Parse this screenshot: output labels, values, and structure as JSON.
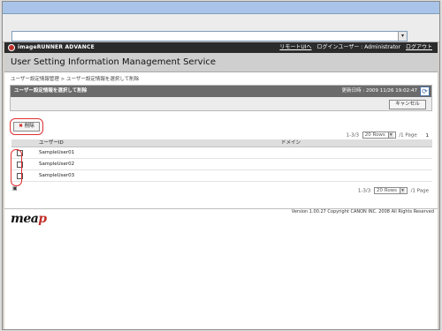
{
  "browser": {
    "address": "",
    "dropdown_icon": "▾"
  },
  "brandbar": {
    "product": "imageRUNNER ADVANCE",
    "remote_ui_link": "リモートUIへ",
    "login_user": "ログインユーザー : Administrator",
    "logout_link": "ログアウト"
  },
  "page": {
    "title": "User Setting Information Management Service",
    "breadcrumb": "ユーザー設定情報管理 > ユーザー設定情報を選択して削除"
  },
  "panel": {
    "title": "ユーザー設定情報を選択して削除",
    "updated": "更新日時 : 2009 11/26 19:02:47",
    "cancel_label": "キャンセル"
  },
  "toolbar": {
    "delete_icon": "✖",
    "delete_label": "削除"
  },
  "pager_top": {
    "range": "1-3/3",
    "rows_select": "20 Rows",
    "pages": "/1 Page",
    "page_num": "1"
  },
  "pager_bottom": {
    "range": "1-3/3",
    "rows_select": "20 Rows",
    "pages": "/1 Page"
  },
  "table": {
    "columns": [
      "ユーザーID",
      "ドメイン"
    ],
    "rows": [
      {
        "user_id": "SampleUser01",
        "domain": ""
      },
      {
        "user_id": "SampleUser02",
        "domain": ""
      },
      {
        "user_id": "SampleUser03",
        "domain": ""
      }
    ]
  },
  "footer": {
    "logo_text": "mea",
    "logo_text2": "p",
    "copyright": "Version 1.00.27 Copyright CANON INC. 2008 All Rights Reserved"
  }
}
